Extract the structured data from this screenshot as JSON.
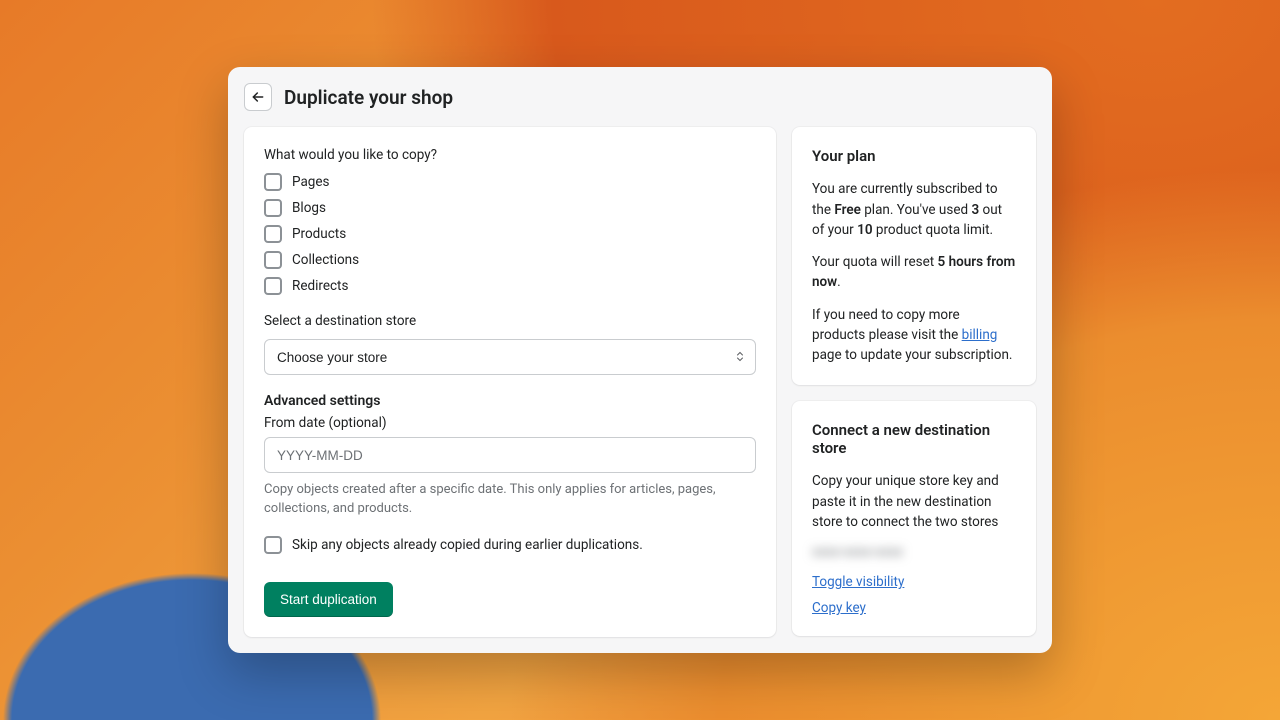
{
  "header": {
    "title": "Duplicate your shop"
  },
  "main": {
    "copy_question": "What would you like to copy?",
    "options": {
      "pages": "Pages",
      "blogs": "Blogs",
      "products": "Products",
      "collections": "Collections",
      "redirects": "Redirects"
    },
    "destination_label": "Select a destination store",
    "destination_placeholder": "Choose your store",
    "advanced_heading": "Advanced settings",
    "from_date_label": "From date (optional)",
    "from_date_placeholder": "YYYY-MM-DD",
    "from_date_help": "Copy objects created after a specific date. This only applies for articles, pages, collections, and products.",
    "skip_label": "Skip any objects already copied during earlier duplications.",
    "start_button": "Start duplication"
  },
  "plan": {
    "title": "Your plan",
    "line1_a": "You are currently subscribed to the ",
    "line1_plan": "Free",
    "line1_b": " plan. You've used ",
    "used": "3",
    "line1_c": " out of your ",
    "limit": "10",
    "line1_d": " product quota limit.",
    "line2_a": "Your quota will reset ",
    "reset_time": "5 hours from now",
    "line2_b": ".",
    "line3_a": "If you need to copy more products please visit the ",
    "billing_link": "billing",
    "line3_b": " page to update your subscription."
  },
  "connect": {
    "title": "Connect a new destination store",
    "desc": "Copy your unique store key and paste it in the new destination store to connect the two stores",
    "key_masked": "xxxx-xxxx-xxxx",
    "toggle": "Toggle visibility",
    "copy": "Copy key"
  }
}
